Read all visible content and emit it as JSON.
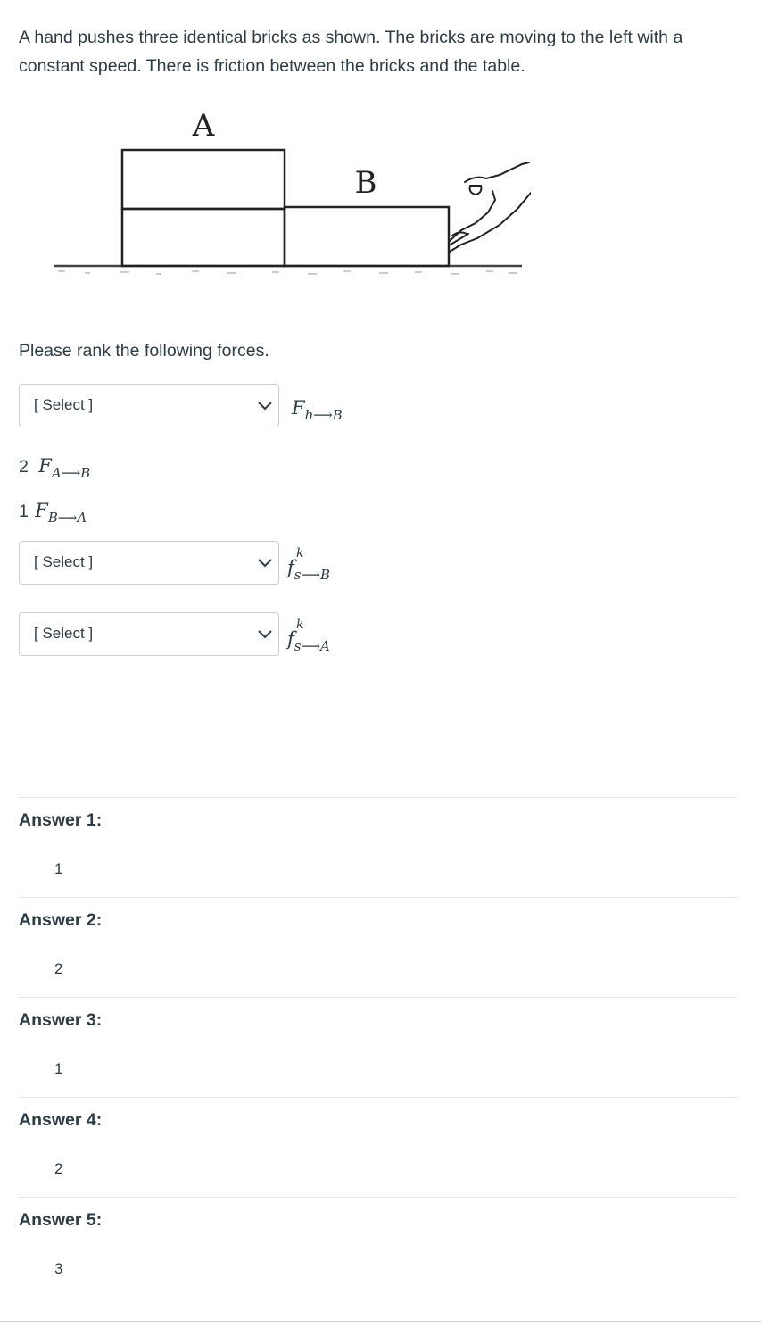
{
  "question": {
    "text": "A hand pushes three identical bricks as shown. The bricks are moving to the left with a constant speed. There is friction between the bricks and the table."
  },
  "figure": {
    "label_a": "A",
    "label_b": "B"
  },
  "prompt": "Please rank the following forces.",
  "dropdowns": [
    {
      "selected": "[ Select ]",
      "force": "F",
      "force_sub": "h⟶B"
    },
    {
      "selected": "[ Select ]",
      "force": "f",
      "force_sup": "k",
      "force_sub": "s⟶B"
    },
    {
      "selected": "[ Select ]",
      "force": "f",
      "force_sup": "k",
      "force_sub": "s⟶A"
    }
  ],
  "given": [
    {
      "rank": "2",
      "force": "F",
      "force_sub": "A⟶B"
    },
    {
      "rank": "1",
      "force": "F",
      "force_sub": "B⟶A"
    }
  ],
  "answers": [
    {
      "label": "Answer 1:",
      "value": "1"
    },
    {
      "label": "Answer 2:",
      "value": "2"
    },
    {
      "label": "Answer 3:",
      "value": "1"
    },
    {
      "label": "Answer 4:",
      "value": "2"
    },
    {
      "label": "Answer 5:",
      "value": "3"
    }
  ],
  "icons": {
    "dropdown": "chevron-down-icon"
  },
  "colors": {
    "text": "#2d3b45",
    "border": "#c7cdd1",
    "divider": "#e3e6e8"
  }
}
